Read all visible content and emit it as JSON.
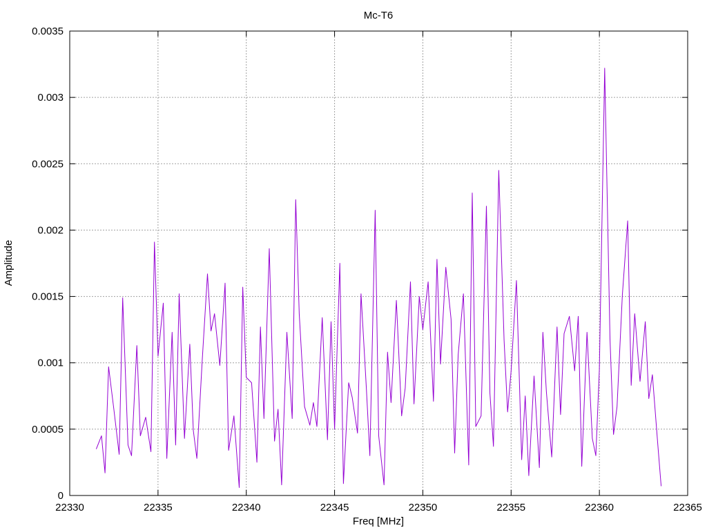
{
  "chart_data": {
    "type": "line",
    "title": "Mc-T6",
    "xlabel": "Freq [MHz]",
    "ylabel": "Amplitude",
    "xlim": [
      22330,
      22365
    ],
    "ylim": [
      0,
      0.0035
    ],
    "xticks": [
      22330,
      22335,
      22340,
      22345,
      22350,
      22355,
      22360,
      22365
    ],
    "xtick_labels": [
      "22330",
      "22335",
      "22340",
      "22345",
      "22350",
      "22355",
      "22360",
      "22365"
    ],
    "yticks": [
      0,
      0.0005,
      0.001,
      0.0015,
      0.002,
      0.0025,
      0.003,
      0.0035
    ],
    "ytick_labels": [
      "0",
      "0.0005",
      "0.001",
      "0.0015",
      "0.002",
      "0.0025",
      "0.003",
      "0.0035"
    ],
    "grid": true,
    "legend": "none",
    "series": [
      {
        "color": "#9400d3",
        "x": [
          22331.5,
          22331.8,
          22332.0,
          22332.2,
          22332.5,
          22332.8,
          22333.0,
          22333.3,
          22333.5,
          22333.8,
          22334.0,
          22334.3,
          22334.6,
          22334.8,
          22335.0,
          22335.3,
          22335.5,
          22335.8,
          22336.0,
          22336.2,
          22336.5,
          22336.8,
          22337.0,
          22337.2,
          22337.5,
          22337.8,
          22338.0,
          22338.2,
          22338.5,
          22338.8,
          22339.0,
          22339.3,
          22339.6,
          22339.8,
          22340.0,
          22340.3,
          22340.6,
          22340.8,
          22341.0,
          22341.3,
          22341.6,
          22341.8,
          22342.0,
          22342.3,
          22342.6,
          22342.8,
          22343.0,
          22343.3,
          22343.6,
          22343.8,
          22344.0,
          22344.3,
          22344.6,
          22344.8,
          22345.0,
          22345.3,
          22345.5,
          22345.8,
          22346.0,
          22346.3,
          22346.5,
          22346.8,
          22347.0,
          22347.3,
          22347.5,
          22347.8,
          22348.0,
          22348.2,
          22348.5,
          22348.8,
          22349.0,
          22349.3,
          22349.5,
          22349.8,
          22350.0,
          22350.3,
          22350.6,
          22350.8,
          22351.0,
          22351.3,
          22351.6,
          22351.8,
          22352.0,
          22352.3,
          22352.6,
          22352.8,
          22353.0,
          22353.3,
          22353.6,
          22353.8,
          22354.0,
          22354.3,
          22354.6,
          22354.8,
          22355.0,
          22355.3,
          22355.6,
          22355.8,
          22356.0,
          22356.3,
          22356.6,
          22356.8,
          22357.0,
          22357.3,
          22357.6,
          22357.8,
          22358.0,
          22358.3,
          22358.6,
          22358.8,
          22359.0,
          22359.3,
          22359.6,
          22359.8,
          22360.0,
          22360.3,
          22360.6,
          22360.8,
          22361.0,
          22361.3,
          22361.6,
          22361.8,
          22362.0,
          22362.3,
          22362.6,
          22362.8,
          22363.0,
          22363.3,
          22363.5
        ],
        "y": [
          0.00035,
          0.00045,
          0.00017,
          0.00097,
          0.00065,
          0.00031,
          0.00149,
          0.00038,
          0.0003,
          0.00113,
          0.00045,
          0.00059,
          0.00033,
          0.00191,
          0.00105,
          0.00145,
          0.00028,
          0.00123,
          0.00038,
          0.00152,
          0.00043,
          0.00114,
          0.00049,
          0.00028,
          0.00101,
          0.00167,
          0.00124,
          0.00137,
          0.00098,
          0.0016,
          0.00034,
          0.0006,
          6e-05,
          0.00157,
          0.00089,
          0.00085,
          0.00025,
          0.00127,
          0.00058,
          0.00186,
          0.00041,
          0.00065,
          8e-05,
          0.00123,
          0.00058,
          0.00223,
          0.00137,
          0.00067,
          0.00053,
          0.0007,
          0.00052,
          0.00134,
          0.00042,
          0.00131,
          0.0005,
          0.00175,
          9e-05,
          0.00085,
          0.00074,
          0.00047,
          0.00152,
          0.00081,
          0.0003,
          0.00215,
          0.00045,
          8e-05,
          0.00108,
          0.0007,
          0.00147,
          0.0006,
          0.00081,
          0.00161,
          0.00069,
          0.0015,
          0.00125,
          0.00161,
          0.00071,
          0.00178,
          0.00099,
          0.00172,
          0.00133,
          0.00032,
          0.00106,
          0.00152,
          0.00023,
          0.00228,
          0.00052,
          0.0006,
          0.00218,
          0.00077,
          0.00037,
          0.00245,
          0.00117,
          0.00063,
          0.00094,
          0.00162,
          0.00027,
          0.00075,
          0.00015,
          0.0009,
          0.00021,
          0.00123,
          0.00078,
          0.00029,
          0.00127,
          0.00061,
          0.00122,
          0.00135,
          0.00094,
          0.00135,
          0.00022,
          0.00123,
          0.00043,
          0.0003,
          0.00095,
          0.00322,
          0.00118,
          0.00046,
          0.00067,
          0.00151,
          0.00207,
          0.00083,
          0.00137,
          0.00086,
          0.00131,
          0.00073,
          0.00091,
          0.0004,
          7e-05
        ]
      }
    ]
  }
}
